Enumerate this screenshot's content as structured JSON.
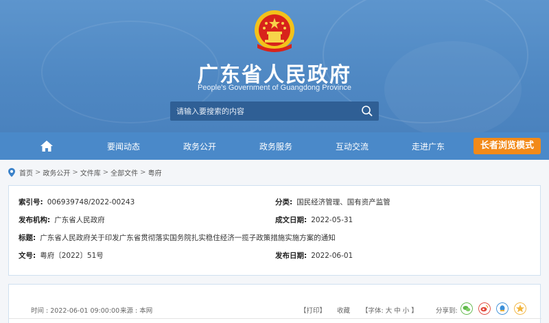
{
  "header": {
    "title": "广东省人民政府",
    "subtitle": "People's Government of Guangdong Province",
    "search_placeholder": "请输入要搜索的内容"
  },
  "nav": {
    "items": [
      "要闻动态",
      "政务公开",
      "政务服务",
      "互动交流",
      "走进广东"
    ],
    "elder_mode": "长者浏览模式"
  },
  "breadcrumb": [
    "首页",
    "政务公开",
    "文件库",
    "全部文件",
    "粤府"
  ],
  "meta": {
    "index_label": "索引号:",
    "index_value": "006939748/2022-00243",
    "category_label": "分类:",
    "category_value": "国民经济管理、国有资产监管",
    "publisher_label": "发布机构:",
    "publisher_value": "广东省人民政府",
    "written_label": "成文日期:",
    "written_value": "2022-05-31",
    "title_label": "标题:",
    "title_value": "广东省人民政府关于印发广东省贯彻落实国务院扎实稳住经济一揽子政策措施实施方案的通知",
    "docno_label": "文号:",
    "docno_value": "粤府〔2022〕51号",
    "pubdate_label": "发布日期:",
    "pubdate_value": "2022-06-01"
  },
  "article_bar": {
    "time": "时间 : 2022-06-01 09:00:00",
    "source": "来源 : 本网",
    "print": "【打印】",
    "favorite": "收藏",
    "font_size": "【字体: 大  中  小 】",
    "share_label": "分享到:"
  },
  "colors": {
    "banner": "#4f88c3",
    "nav": "#4a89c9",
    "elder_button": "#f28a19"
  }
}
